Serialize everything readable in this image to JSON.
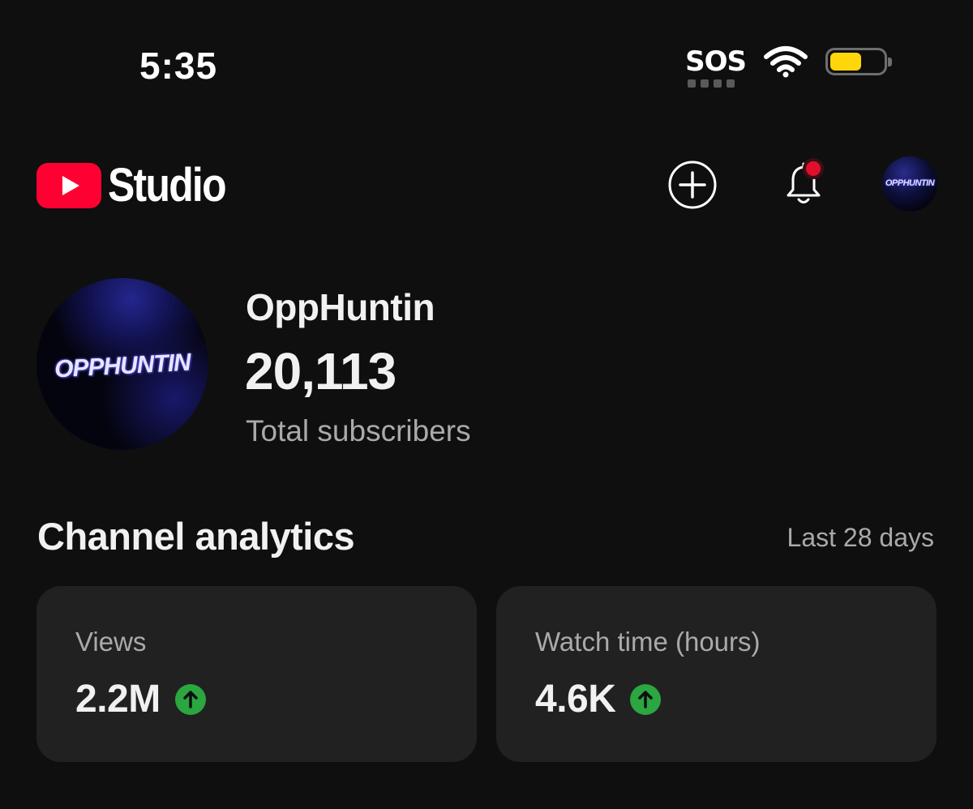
{
  "status_bar": {
    "time": "5:35",
    "carrier_status": "SOS",
    "battery_level_percent": 60,
    "battery_color": "#ffd60a"
  },
  "header": {
    "app_name": "Studio",
    "logo_icon": "youtube-play-icon",
    "brand_color": "#ff0033",
    "create_icon": "plus-circle-icon",
    "notifications_icon": "bell-icon",
    "notification_dot_color": "#e0102c",
    "avatar_text": "OPPHUNTIN"
  },
  "channel": {
    "name": "OppHuntin",
    "avatar_text": "OPPHUNTIN",
    "subscriber_count": "20,113",
    "subscriber_label": "Total subscribers"
  },
  "analytics": {
    "title": "Channel analytics",
    "range": "Last 28 days",
    "trend_color": "#2ba640",
    "cards": [
      {
        "label": "Views",
        "value": "2.2M",
        "trend": "up"
      },
      {
        "label": "Watch time (hours)",
        "value": "4.6K",
        "trend": "up"
      }
    ]
  }
}
